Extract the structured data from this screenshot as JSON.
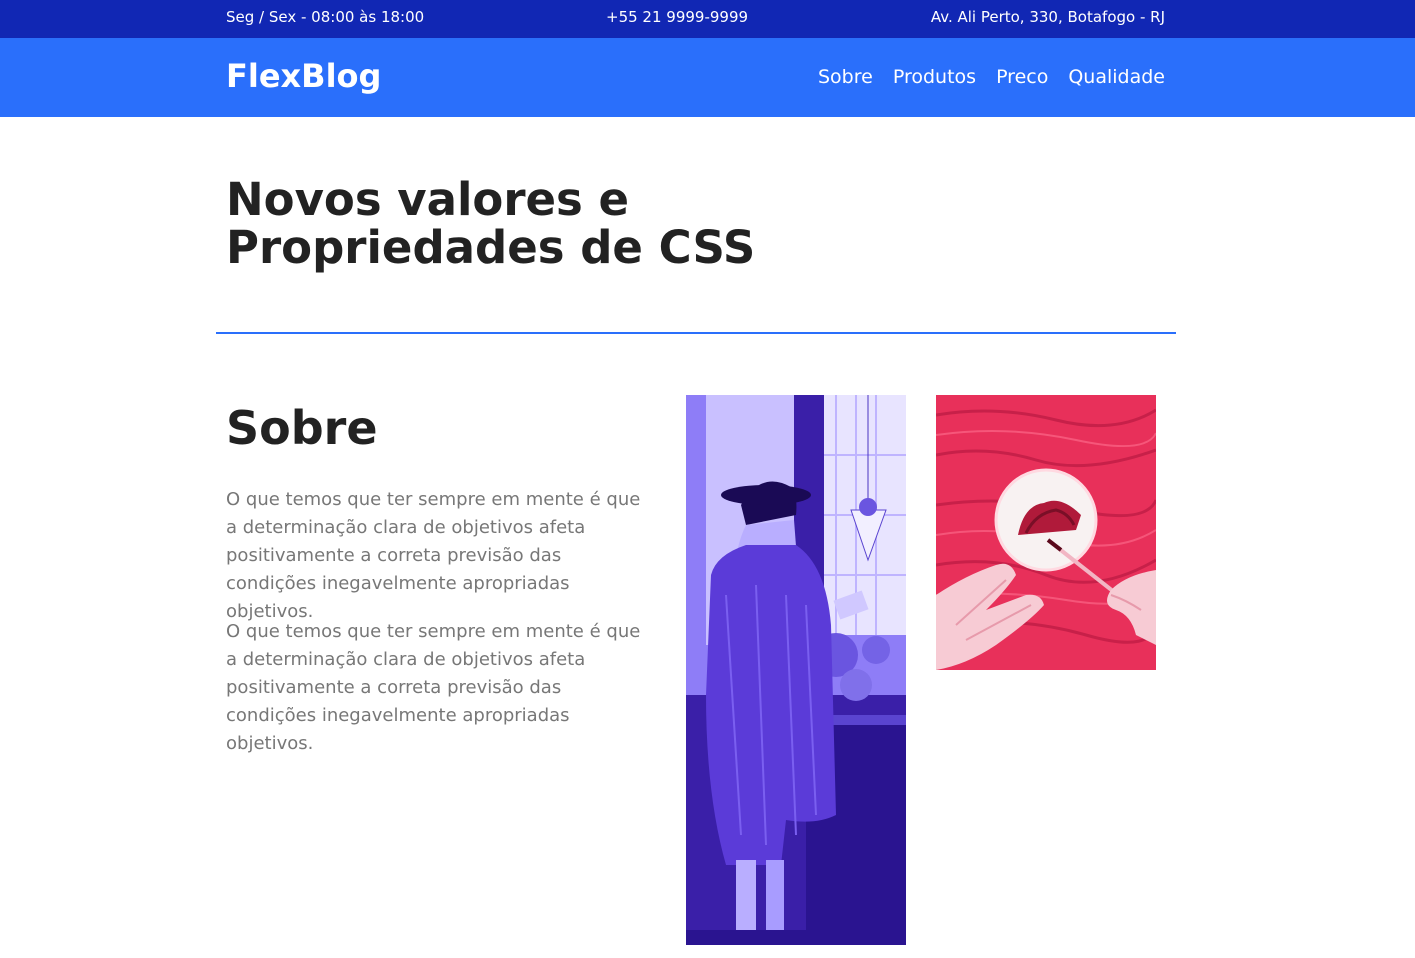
{
  "topbar": {
    "hours": "Seg / Sex - 08:00 às 18:00",
    "phone": "+55 21 9999-9999",
    "address": "Av. Ali Perto, 330, Botafogo - RJ",
    "background": "#1127b4"
  },
  "header": {
    "logo": "FlexBlog",
    "background": "#2a6ffb",
    "nav": [
      {
        "label": "Sobre"
      },
      {
        "label": "Produtos"
      },
      {
        "label": "Preco"
      },
      {
        "label": "Qualidade"
      }
    ]
  },
  "hero": {
    "title": "Novos valores e Propriedades de CSS",
    "divider_color": "#2a6ffb"
  },
  "about": {
    "title": "Sobre",
    "paragraphs": [
      "O que temos que ter sempre em mente é que a determinação clara de objetivos afeta positivamente a correta previsão das condições inegavelmente apropriadas objetivos.",
      "O que temos que ter sempre em mente é que a determinação clara de objetivos afeta positivamente a correta previsão das condições inegavelmente apropriadas objetivos."
    ]
  },
  "images": {
    "photo_1": {
      "icon": "woman-photo",
      "tint": "#5b3bf0"
    },
    "photo_2": {
      "icon": "painting-hands-photo",
      "tint": "#f0325d"
    }
  }
}
